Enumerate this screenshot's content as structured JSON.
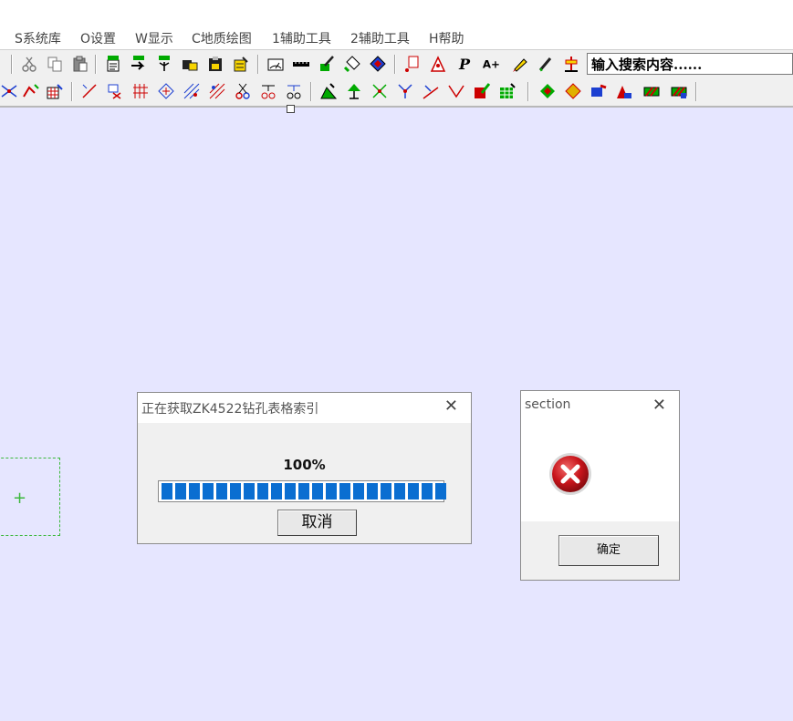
{
  "menu": {
    "items": [
      {
        "label": "S系统库"
      },
      {
        "label": "O设置"
      },
      {
        "label": "W显示"
      },
      {
        "label": "C地质绘图"
      },
      {
        "label": "1辅助工具"
      },
      {
        "label": "2辅助工具"
      },
      {
        "label": "H帮助"
      }
    ]
  },
  "toolbar": {
    "search_text": "输入搜索内容......"
  },
  "progress_dialog": {
    "title": "正在获取ZK4522钻孔表格索引",
    "percent_label": "100%",
    "progress": 1.0,
    "cancel_label": "取消"
  },
  "message_dialog": {
    "title": "section",
    "ok_label": "确定",
    "icon": "error-icon"
  },
  "colors": {
    "canvas": "#e6e6ff",
    "progress": "#0a6ed1",
    "selection": "#3cb83c",
    "error": "#c8151b"
  }
}
